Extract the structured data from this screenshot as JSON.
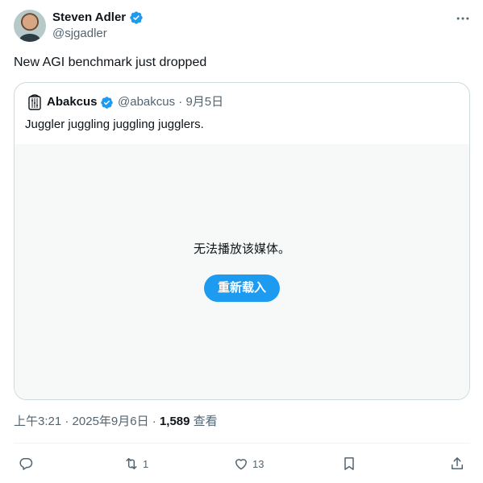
{
  "author": {
    "name": "Steven Adler",
    "handle": "@sjgadler"
  },
  "tweet": {
    "text": "New AGI benchmark just dropped"
  },
  "quoted_tweet": {
    "name": "Abakcus",
    "handle": "@abakcus",
    "separator": "·",
    "date": "9月5日",
    "text": "Juggler juggling juggling jugglers.",
    "media_error": "无法播放该媒体。",
    "reload_label": "重新载入"
  },
  "meta": {
    "time": "上午3:21",
    "date": "2025年9月6日",
    "separator": "·",
    "views": "1,589",
    "views_label": "查看"
  },
  "actions": {
    "reply_count": "",
    "retweet_count": "1",
    "like_count": "13"
  },
  "colors": {
    "accent": "#1d9bf0",
    "text": "#0f1419",
    "secondary": "#536471",
    "border": "#cfd9de",
    "media_bg": "#f7f9f9"
  },
  "icons": {
    "verified": "verified-badge-icon",
    "more": "more-horizontal-icon",
    "reply": "reply-icon",
    "retweet": "retweet-icon",
    "like": "heart-icon",
    "bookmark": "bookmark-icon",
    "share": "share-icon"
  }
}
